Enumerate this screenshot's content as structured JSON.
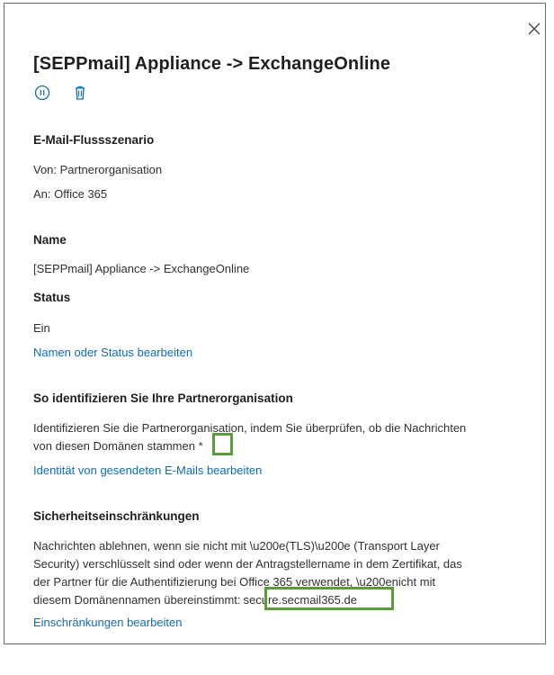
{
  "panel": {
    "title": "[SEPPmail] Appliance -> ExchangeOnline",
    "toolbar": {
      "pause_icon": "pause-circle-icon",
      "delete_icon": "trash-icon"
    },
    "close_icon": "close-icon"
  },
  "mail_flow": {
    "heading": "E-Mail-Flussszenario",
    "from": "Von: Partnerorganisation",
    "to": "An: Office 365"
  },
  "name": {
    "heading": "Name",
    "value": "[SEPPmail] Appliance -> ExchangeOnline"
  },
  "status": {
    "heading": "Status",
    "value": "Ein",
    "edit_link": "Namen oder Status bearbeiten"
  },
  "identify": {
    "heading": "So identifizieren Sie Ihre Partnerorganisation",
    "text_line1": "Identifizieren Sie die Partnerorganisation, indem Sie überprüfen, ob die Nachrichten",
    "text_line2": "von diesen Domänen stammen",
    "domain_value": "*",
    "edit_link": "Identität von gesendeten E-Mails bearbeiten"
  },
  "security": {
    "heading": "Sicherheitseinschränkungen",
    "text_line1": "Nachrichten ablehnen, wenn sie nicht mit \\u200e(TLS)\\u200e (Transport Layer",
    "text_line2": "Security) verschlüsselt sind oder wenn der Antragstellername in dem Zertifikat, das",
    "text_line3": "der Partner für die Authentifizierung bei Office 365 verwendet, \\u200enicht mit",
    "text_line4": "diesem Domänennamen übereinstimmt:",
    "domain_value": "secure.secmail365.de",
    "edit_link": "Einschränkungen bearbeiten"
  },
  "colors": {
    "link": "#0f6cbd",
    "highlight": "#5a9b3c",
    "border": "#6b6b6b"
  }
}
